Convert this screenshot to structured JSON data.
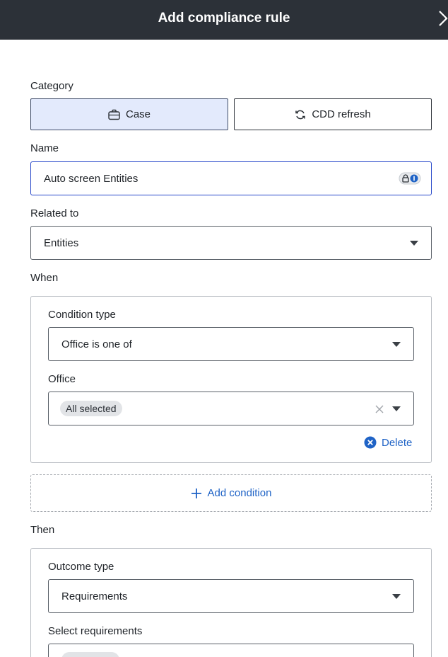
{
  "dialog": {
    "title": "Add compliance rule"
  },
  "category": {
    "label": "Category",
    "options": [
      {
        "label": "Case",
        "icon": "briefcase-icon",
        "selected": true
      },
      {
        "label": "CDD refresh",
        "icon": "refresh-icon",
        "selected": false
      }
    ]
  },
  "name": {
    "label": "Name",
    "value": "Auto screen Entities"
  },
  "related_to": {
    "label": "Related to",
    "value": "Entities"
  },
  "when": {
    "label": "When",
    "condition_type": {
      "label": "Condition type",
      "value": "Office is one of"
    },
    "office": {
      "label": "Office",
      "chip": "All selected"
    },
    "delete_label": "Delete",
    "add_condition_label": "Add condition"
  },
  "then": {
    "label": "Then",
    "outcome_type": {
      "label": "Outcome type",
      "value": "Requirements"
    },
    "select_requirements": {
      "label": "Select requirements"
    }
  },
  "colors": {
    "header_bg": "#2c3138",
    "accent": "#1f63c6",
    "selected_bg": "#e3eafc",
    "focus_border": "#2747c9"
  }
}
